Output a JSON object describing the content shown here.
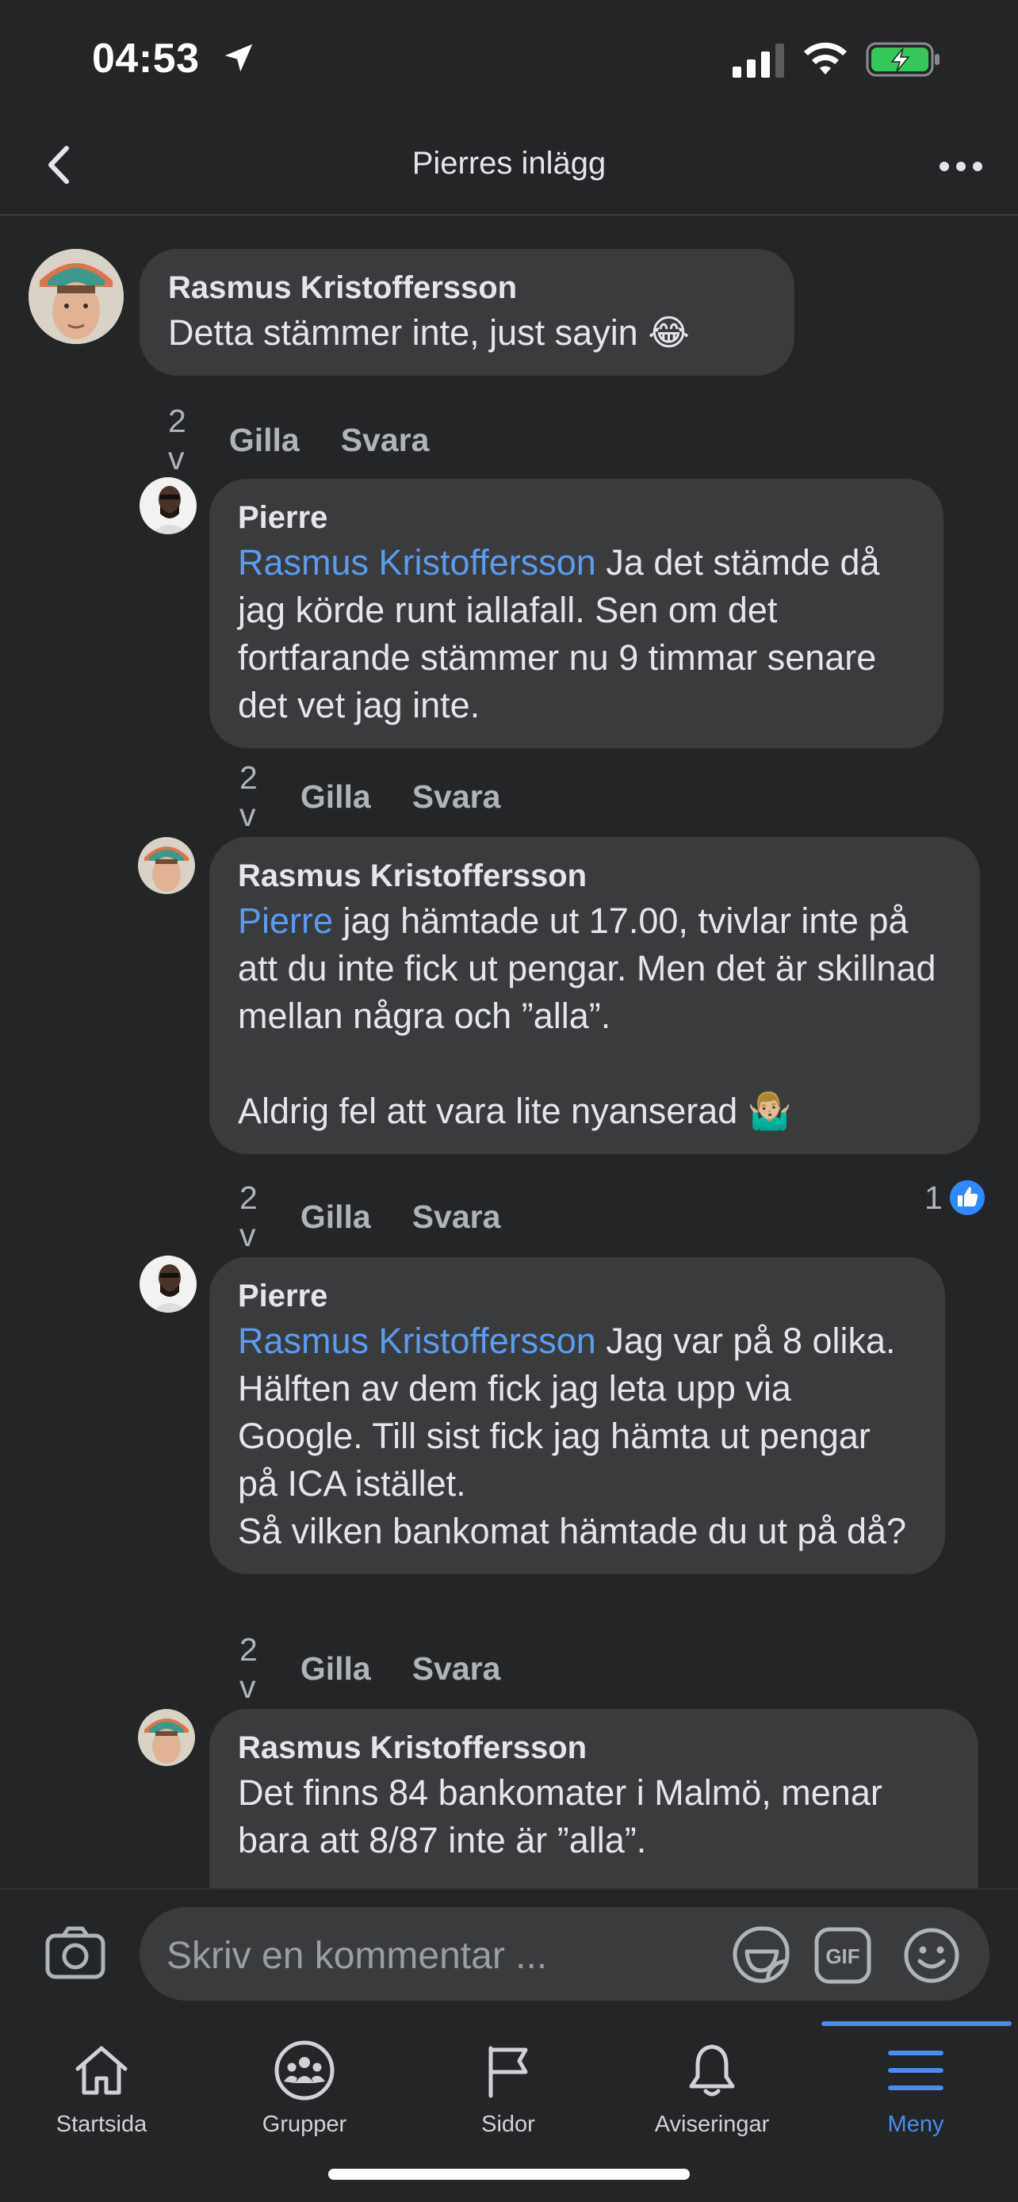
{
  "status_bar": {
    "time": "04:53"
  },
  "header": {
    "title": "Pierres inlägg"
  },
  "comments": [
    {
      "author": "Rasmus Kristoffersson",
      "text": "Detta stämmer inte, just sayin 😂",
      "time": "2 v",
      "like": "Gilla",
      "reply": "Svara"
    },
    {
      "author": "Pierre",
      "mention": "Rasmus Kristoffersson",
      "text": " Ja det stämde då jag körde runt iallafall. Sen om det fortfarande stämmer nu 9 timmar senare det vet jag inte.",
      "time": "2 v",
      "like": "Gilla",
      "reply": "Svara"
    },
    {
      "author": "Rasmus Kristoffersson",
      "mention": "Pierre",
      "text": " jag hämtade ut 17.00, tvivlar inte på att du inte fick ut pengar. Men det är skillnad mellan några och ”alla”.\n\nAldrig fel att vara lite nyanserad 🤷🏼‍♂️",
      "time": "2 v",
      "like": "Gilla",
      "reply": "Svara",
      "reaction_count": "1"
    },
    {
      "author": "Pierre",
      "mention": "Rasmus Kristoffersson",
      "text": " Jag var på 8 olika. Hälften av dem fick jag leta upp via Google. Till sist fick jag hämta ut pengar på ICA istället.\nSå vilken bankomat hämtade du ut på då?",
      "time": "2 v",
      "like": "Gilla",
      "reply": "Svara"
    },
    {
      "author": "Rasmus Kristoffersson",
      "text": "Det finns 84 bankomater i Malmö, menar bara att 8/87 inte är ”alla”."
    }
  ],
  "composer": {
    "placeholder": "Skriv en kommentar ..."
  },
  "tabs": [
    {
      "label": "Startsida",
      "icon": "home-icon"
    },
    {
      "label": "Grupper",
      "icon": "groups-icon"
    },
    {
      "label": "Sidor",
      "icon": "flag-icon"
    },
    {
      "label": "Aviseringar",
      "icon": "bell-icon"
    },
    {
      "label": "Meny",
      "icon": "menu-icon",
      "active": true
    }
  ],
  "colors": {
    "background": "#242526",
    "bubble": "#3a3b3c",
    "mention": "#5b9bf0",
    "accent": "#4a8cf0"
  }
}
